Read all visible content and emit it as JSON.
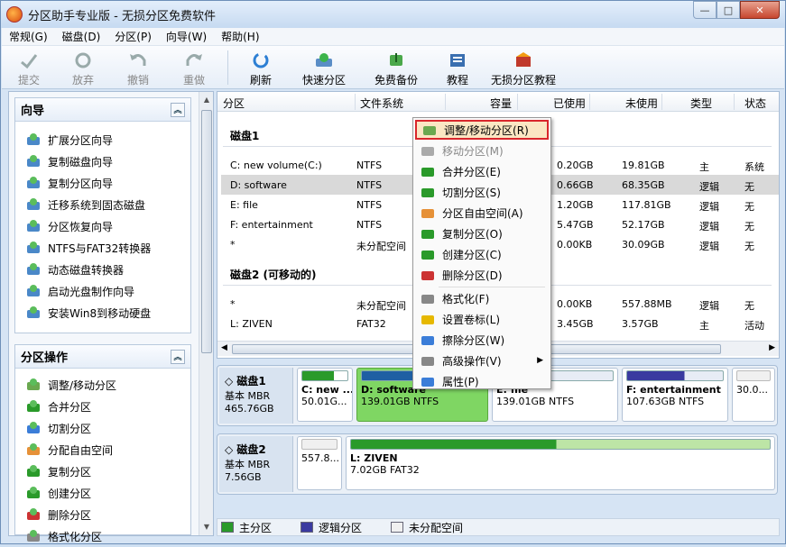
{
  "window": {
    "title": "分区助手专业版 - 无损分区免费软件",
    "min": "—",
    "max": "□",
    "close": "✕"
  },
  "menu": [
    "常规(G)",
    "磁盘(D)",
    "分区(P)",
    "向导(W)",
    "帮助(H)"
  ],
  "toolbar": {
    "commit": "提交",
    "discard": "放弃",
    "undo": "撤销",
    "redo": "重做",
    "refresh": "刷新",
    "quick_partition": "快速分区",
    "free_backup": "免费备份",
    "tutorial": "教程",
    "lossless_tutorial": "无损分区教程"
  },
  "wizard_panel": {
    "title": "向导",
    "items": [
      "扩展分区向导",
      "复制磁盘向导",
      "复制分区向导",
      "迁移系统到固态磁盘",
      "分区恢复向导",
      "NTFS与FAT32转换器",
      "动态磁盘转换器",
      "启动光盘制作向导",
      "安装Win8到移动硬盘"
    ]
  },
  "ops_panel": {
    "title": "分区操作",
    "items": [
      "调整/移动分区",
      "合并分区",
      "切割分区",
      "分配自由空间",
      "复制分区",
      "创建分区",
      "删除分区",
      "格式化分区"
    ]
  },
  "columns": [
    "分区",
    "文件系统",
    "容量",
    "已使用",
    "未使用",
    "类型",
    "状态"
  ],
  "disk1": {
    "title": "磁盘1",
    "rows": [
      {
        "name": "C: new volume(C:)",
        "fs": "NTFS",
        "used": "0.20GB",
        "free": "19.81GB",
        "type": "主",
        "status": "系统"
      },
      {
        "name": "D: software",
        "fs": "NTFS",
        "used": "0.66GB",
        "free": "68.35GB",
        "type": "逻辑",
        "status": "无"
      },
      {
        "name": "E: file",
        "fs": "NTFS",
        "used": "1.20GB",
        "free": "117.81GB",
        "type": "逻辑",
        "status": "无"
      },
      {
        "name": "F: entertainment",
        "fs": "NTFS",
        "used": "5.47GB",
        "free": "52.17GB",
        "type": "逻辑",
        "status": "无"
      },
      {
        "name": "*",
        "fs": "未分配空间",
        "used": "0.00KB",
        "free": "30.09GB",
        "type": "逻辑",
        "status": "无"
      }
    ]
  },
  "disk2": {
    "title": "磁盘2 (可移动的)",
    "rows": [
      {
        "name": "*",
        "fs": "未分配空间",
        "used": "0.00KB",
        "free": "557.88MB",
        "type": "逻辑",
        "status": "无"
      },
      {
        "name": "L: ZIVEN",
        "fs": "FAT32",
        "used": "3.45GB",
        "free": "3.57GB",
        "type": "主",
        "status": "活动"
      }
    ]
  },
  "map1": {
    "name": "磁盘1",
    "kind": "基本 MBR",
    "size": "465.76GB",
    "parts": [
      {
        "name": "C: new ...",
        "size": "50.01G..."
      },
      {
        "name": "D: software",
        "size": "139.01GB NTFS"
      },
      {
        "name": "E: file",
        "size": "139.01GB NTFS"
      },
      {
        "name": "F: entertainment",
        "size": "107.63GB NTFS"
      },
      {
        "name": "",
        "size": "30.0..."
      }
    ]
  },
  "map2": {
    "name": "磁盘2",
    "kind": "基本 MBR",
    "size": "7.56GB",
    "parts": [
      {
        "name": "",
        "size": "557.8..."
      },
      {
        "name": "L: ZIVEN",
        "size": "7.02GB FAT32"
      }
    ]
  },
  "legend": [
    "主分区",
    "逻辑分区",
    "未分配空间"
  ],
  "context_menu": [
    "调整/移动分区(R)",
    "移动分区(M)",
    "合并分区(E)",
    "切割分区(S)",
    "分区自由空间(A)",
    "复制分区(O)",
    "创建分区(C)",
    "删除分区(D)",
    "格式化(F)",
    "设置卷标(L)",
    "擦除分区(W)",
    "高级操作(V)",
    "属性(P)"
  ],
  "colors": {
    "primary": "#2a9a2a",
    "logical": "#3a3aa0",
    "unallocated": "#f0f0f0",
    "highlight": "#d9262c"
  }
}
